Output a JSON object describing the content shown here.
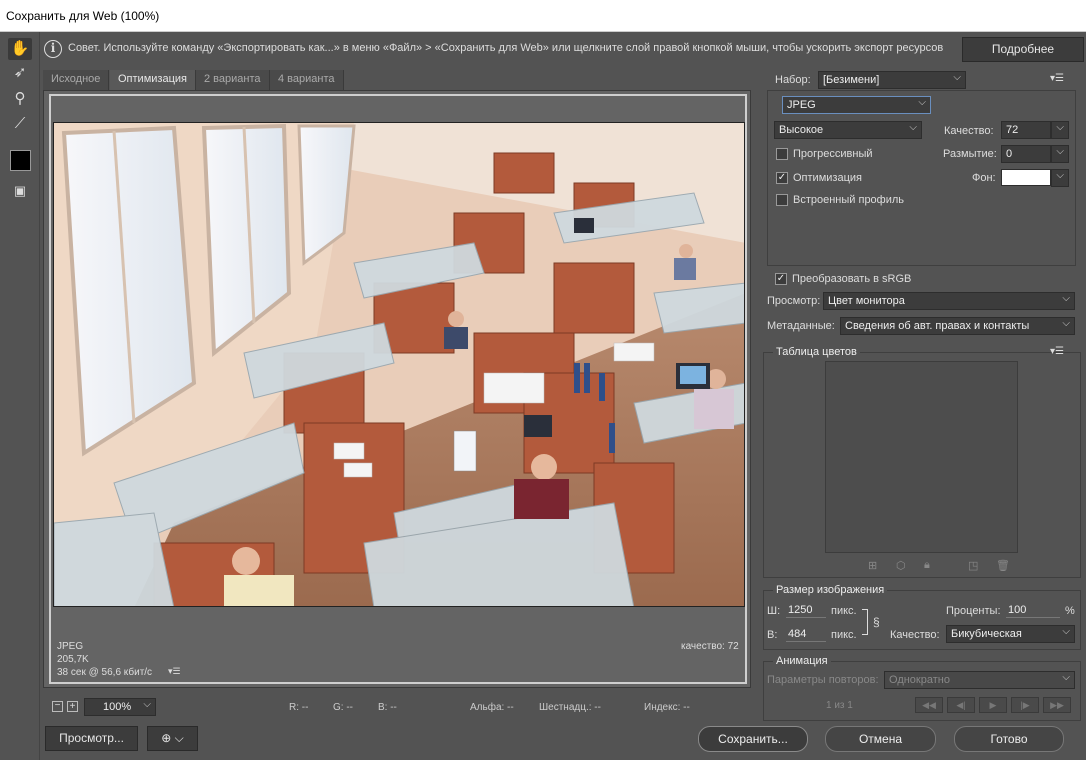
{
  "window": {
    "title": "Сохранить для Web (100%)"
  },
  "tip": {
    "text": "Совет. Используйте команду «Экспортировать как...» в меню «Файл» > «Сохранить для Web» или щелкните слой правой кнопкой мыши, чтобы ускорить экспорт ресурсов",
    "more_button": "Подробнее"
  },
  "tools": [
    "hand-tool",
    "slice-select-tool",
    "zoom-tool",
    "eyedropper-tool",
    "eyedropper-color",
    "toggle-slices"
  ],
  "tabs": [
    "Исходное",
    "Оптимизация",
    "2 варианта",
    "4 варианта"
  ],
  "active_tab": "Оптимизация",
  "image_info": {
    "format": "JPEG",
    "size": "205,7K",
    "time": "38 сек @ 56,6 кбит/с",
    "quality": "качество: 72"
  },
  "status": {
    "zoom": "100%",
    "r": "R: --",
    "g": "G: --",
    "b": "B: --",
    "alpha": "Альфа: --",
    "hex": "Шестнадц.: --",
    "index": "Индекс: --"
  },
  "settings": {
    "preset_label": "Набор:",
    "preset_value": "[Безимени]",
    "format_value": "JPEG",
    "quality_preset": "Высокое",
    "quality_label": "Качество:",
    "quality_value": "72",
    "progressive_label": "Прогрессивный",
    "progressive_checked": false,
    "blur_label": "Размытие:",
    "blur_value": "0",
    "optimized_label": "Оптимизация",
    "optimized_checked": true,
    "matte_label": "Фон:",
    "matte_color": "#ffffff",
    "embed_profile_label": "Встроенный профиль",
    "embed_profile_checked": false,
    "convert_srgb_label": "Преобразовать в sRGB",
    "convert_srgb_checked": true,
    "preview_label": "Просмотр:",
    "preview_value": "Цвет монитора",
    "metadata_label": "Метаданные:",
    "metadata_value": "Сведения об авт. правах и контакты"
  },
  "color_table": {
    "title": "Таблица цветов"
  },
  "image_size": {
    "title": "Размер изображения",
    "w_label": "Ш:",
    "w_value": "1250",
    "h_label": "В:",
    "h_value": "484",
    "unit": "пикс.",
    "percent_label": "Проценты:",
    "percent_value": "100",
    "percent_unit": "%",
    "quality_label": "Качество:",
    "quality_value": "Бикубическая"
  },
  "animation": {
    "title": "Анимация",
    "loop_label": "Параметры повторов:",
    "loop_value": "Однократно",
    "frame_counter": "1 из 1"
  },
  "footer": {
    "preview_button": "Просмотр...",
    "save_button": "Сохранить...",
    "cancel_button": "Отмена",
    "done_button": "Готово"
  }
}
